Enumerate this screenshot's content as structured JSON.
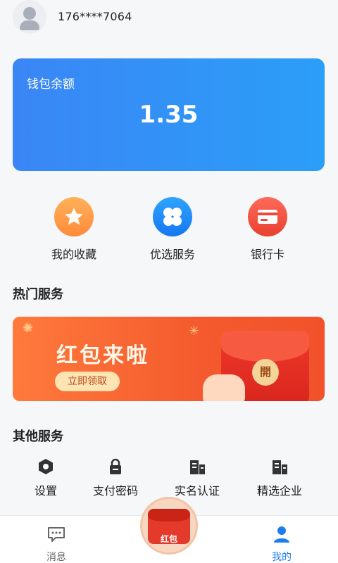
{
  "header": {
    "phone": "176****7064"
  },
  "wallet": {
    "label": "钱包余额",
    "amount": "1.35"
  },
  "actions": [
    {
      "label": "我的收藏",
      "icon": "star-icon",
      "color": "#ff9a45"
    },
    {
      "label": "优选服务",
      "icon": "clover-icon",
      "color": "#1e88f5"
    },
    {
      "label": "银行卡",
      "icon": "bank-card-icon",
      "color": "#ee4a38"
    }
  ],
  "hot_services": {
    "title": "热门服务",
    "banner": {
      "title": "红包来啦",
      "button": "立即领取",
      "seal": "開"
    }
  },
  "other_services": {
    "title": "其他服务",
    "items": [
      {
        "label": "设置",
        "icon": "settings-icon"
      },
      {
        "label": "支付密码",
        "icon": "lock-icon"
      },
      {
        "label": "实名认证",
        "icon": "building-icon"
      },
      {
        "label": "精选企业",
        "icon": "building-icon"
      }
    ]
  },
  "bottom_nav": {
    "items": [
      {
        "label": "消息",
        "icon": "message-icon",
        "active": false
      },
      {
        "label": "我的",
        "icon": "person-icon",
        "active": true
      }
    ],
    "center": {
      "label": "红包",
      "icon": "red-packet-icon"
    }
  }
}
